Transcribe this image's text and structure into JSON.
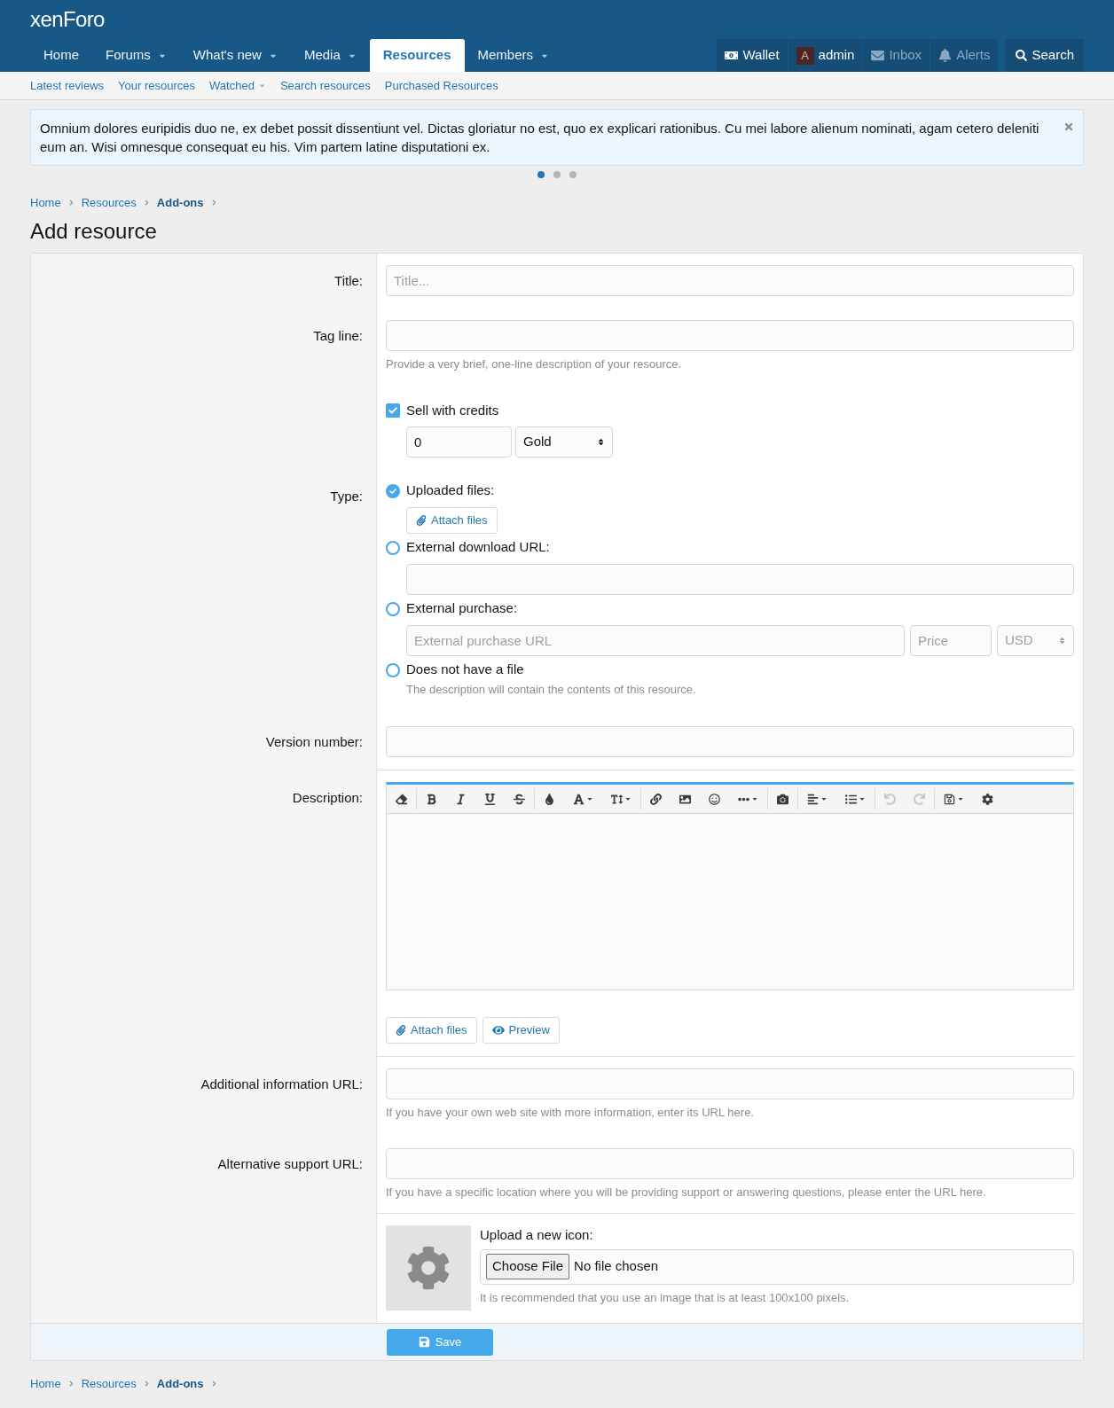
{
  "header": {
    "logo": "xenForo",
    "nav": [
      {
        "label": "Home",
        "selected": false,
        "has_menu": false
      },
      {
        "label": "Forums",
        "selected": false,
        "has_menu": true
      },
      {
        "label": "What's new",
        "selected": false,
        "has_menu": true
      },
      {
        "label": "Media",
        "selected": false,
        "has_menu": true
      },
      {
        "label": "Resources",
        "selected": true,
        "has_menu": false
      },
      {
        "label": "Members",
        "selected": false,
        "has_menu": true
      }
    ],
    "user_nav": [
      {
        "kind": "wallet",
        "label": "Wallet",
        "dimmed": false
      },
      {
        "kind": "account",
        "label": "admin",
        "avatar": "A",
        "dimmed": false
      },
      {
        "kind": "inbox",
        "label": "Inbox",
        "dimmed": true
      },
      {
        "kind": "alerts",
        "label": "Alerts",
        "dimmed": true
      }
    ],
    "search": "Search"
  },
  "subnav": [
    {
      "label": "Latest reviews",
      "has_menu": false
    },
    {
      "label": "Your resources",
      "has_menu": false
    },
    {
      "label": "Watched",
      "has_menu": true
    },
    {
      "label": "Search resources",
      "has_menu": false
    },
    {
      "label": "Purchased Resources",
      "has_menu": false
    }
  ],
  "notice": {
    "text": "Omnium dolores euripidis duo ne, ex debet possit dissentiunt vel. Dictas gloriatur no est, quo ex explicari rationibus. Cu mei labore alienum nominati, agam cetero deleniti eum an. Wisi omnesque consequat eu his. Vim partem latine disputationi ex.",
    "dots": [
      {
        "selected": true
      },
      {
        "selected": false
      },
      {
        "selected": false
      }
    ]
  },
  "breadcrumb": [
    {
      "label": "Home",
      "current": false
    },
    {
      "label": "Resources",
      "current": false
    },
    {
      "label": "Add-ons",
      "current": true
    }
  ],
  "page_title": "Add resource",
  "form": {
    "title": {
      "label": "Title:",
      "placeholder": "Title..."
    },
    "tag_line": {
      "label": "Tag line:",
      "hint": "Provide a very brief, one-line description of your resource."
    },
    "credits": {
      "label": "Sell with credits",
      "checked": true,
      "amount": "0",
      "currency": "Gold"
    },
    "type": {
      "label": "Type:",
      "options": [
        {
          "kind": "attach",
          "label": "Uploaded files:",
          "selected": true,
          "button": "Attach files"
        },
        {
          "kind": "url",
          "label": "External download URL:",
          "selected": false
        },
        {
          "kind": "purchase",
          "label": "External purchase:",
          "selected": false,
          "url_placeholder": "External purchase URL",
          "price_placeholder": "Price",
          "currency": "USD"
        },
        {
          "kind": "none",
          "label": "Does not have a file",
          "selected": false,
          "hint": "The description will contain the contents of this resource."
        }
      ]
    },
    "version": {
      "label": "Version number:"
    },
    "description": {
      "label": "Description:",
      "toolbar": [
        [
          {
            "kind": "clear",
            "has_menu": false,
            "disabled": false
          }
        ],
        [
          {
            "kind": "bold",
            "has_menu": false,
            "disabled": false
          },
          {
            "kind": "italic",
            "has_menu": false,
            "disabled": false
          },
          {
            "kind": "underline",
            "has_menu": false,
            "disabled": false
          },
          {
            "kind": "strike",
            "has_menu": false,
            "disabled": false
          }
        ],
        [
          {
            "kind": "color",
            "has_menu": false,
            "disabled": false
          },
          {
            "kind": "font",
            "has_menu": true,
            "disabled": false
          },
          {
            "kind": "size",
            "has_menu": true,
            "disabled": false
          }
        ],
        [
          {
            "kind": "link",
            "has_menu": false,
            "disabled": false
          },
          {
            "kind": "image",
            "has_menu": false,
            "disabled": false
          },
          {
            "kind": "smilie",
            "has_menu": false,
            "disabled": false
          },
          {
            "kind": "more",
            "has_menu": true,
            "disabled": false
          }
        ],
        [
          {
            "kind": "media",
            "has_menu": false,
            "disabled": false
          }
        ],
        [
          {
            "kind": "align",
            "has_menu": true,
            "disabled": false
          },
          {
            "kind": "list",
            "has_menu": true,
            "disabled": false
          }
        ],
        [
          {
            "kind": "undo",
            "has_menu": false,
            "disabled": true
          },
          {
            "kind": "redo",
            "has_menu": false,
            "disabled": true
          }
        ],
        [
          {
            "kind": "drafts",
            "has_menu": true,
            "disabled": false
          },
          {
            "kind": "settings",
            "has_menu": false,
            "disabled": false
          }
        ]
      ],
      "attach": "Attach files",
      "preview": "Preview"
    },
    "info_url": {
      "label": "Additional information URL:",
      "hint": "If you have your own web site with more information, enter its URL here."
    },
    "support_url": {
      "label": "Alternative support URL:",
      "hint": "If you have a specific location where you will be providing support or answering questions, please enter the URL here."
    },
    "icon": {
      "label": "Upload a new icon:",
      "button": "Choose File",
      "status": "No file chosen",
      "hint": "It is recommended that you use an image that is at least 100x100 pixels."
    },
    "save": "Save"
  },
  "footer_breadcrumb": [
    {
      "label": "Home",
      "current": false
    },
    {
      "label": "Resources",
      "current": false
    },
    {
      "label": "Add-ons",
      "current": true
    }
  ]
}
